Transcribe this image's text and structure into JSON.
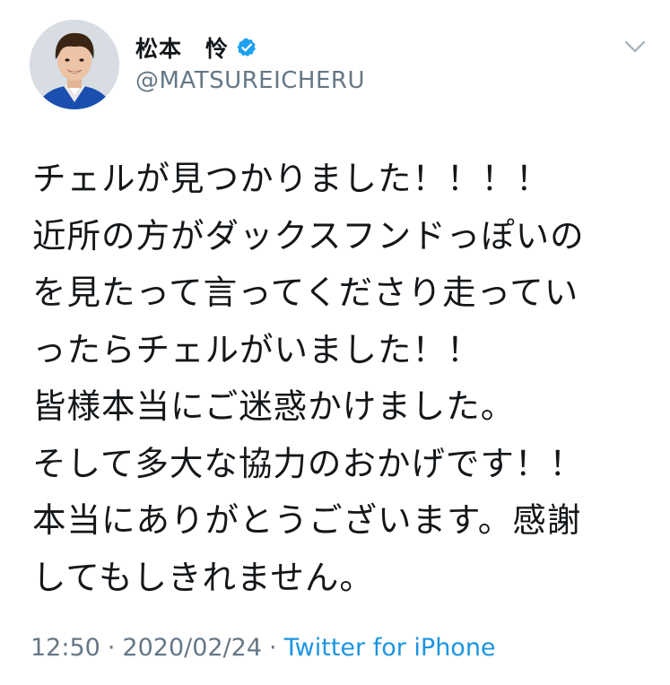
{
  "user": {
    "display_name": "松本　怜",
    "handle": "@MATSUREICHERU",
    "verified_icon": "verified-badge-icon",
    "avatar_icon": "profile-photo"
  },
  "menu": {
    "icon": "chevron-down-icon"
  },
  "tweet": {
    "lines": [
      "チェルが見つかりました！！！！",
      "近所の方がダックスフンドっぽいの",
      "を見たって言ってくださり走ってい",
      "ったらチェルがいました！！",
      "皆様本当にご迷惑かけました。",
      "そして多大な協力のおかげです！！",
      "本当にありがとうございます。感謝",
      "してもしきれません。"
    ]
  },
  "meta": {
    "time": "12:50",
    "separator": "·",
    "date": "2020/02/24",
    "source": "Twitter for iPhone"
  },
  "colors": {
    "text": "#14171a",
    "secondary": "#657786",
    "link": "#1b95e0",
    "verified": "#1da1f2"
  }
}
